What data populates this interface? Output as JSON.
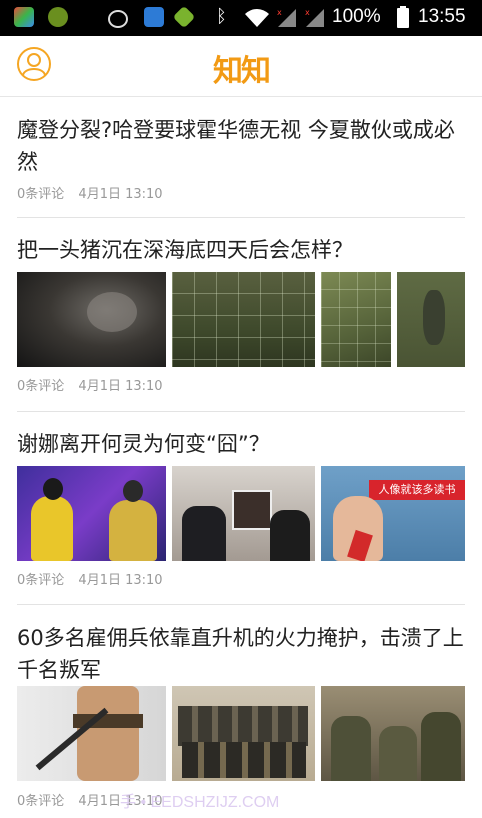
{
  "status_bar": {
    "battery_percent": "100%",
    "time": "13:55"
  },
  "header": {
    "logo_text": "知知",
    "avatar_icon": "user-circle-icon",
    "accent_color": "#f29a14"
  },
  "articles": [
    {
      "title": "魔登分裂?哈登要球霍华德无视 今夏散伙或成必然",
      "comments": "0条评论",
      "date": "4月1日 13:10",
      "thumbnails": []
    },
    {
      "title": "把一头猪沉在深海底四天后会怎样？",
      "comments": "0条评论",
      "date": "4月1日 13:10",
      "thumbnails": [
        "underwater-photo-1",
        "underwater-photo-2",
        "underwater-photo-3",
        "underwater-photo-4"
      ]
    },
    {
      "title": "谢娜离开何灵为何变“囧”？",
      "comments": "0条评论",
      "date": "4月1日 13:10",
      "thumbnails": [
        "tv-show-photo",
        "press-event-photo",
        "propaganda-poster"
      ],
      "poster_caption": "人像就该多读书"
    },
    {
      "title": "60多名雇佣兵依靠直升机的火力掩护，击溃了上千名叛军",
      "comments": "0条评论",
      "date": "4月1日 13:10",
      "thumbnails": [
        "soldier-photo",
        "mercenary-group-photo",
        "soldiers-firing-photo"
      ]
    }
  ],
  "watermark": "手 • EEDSHZIJZ.COM"
}
